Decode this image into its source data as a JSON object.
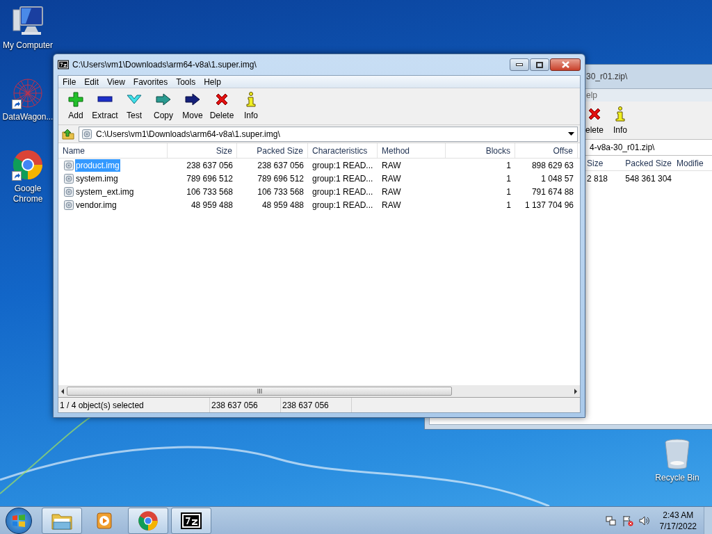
{
  "desktop_icons": [
    {
      "label": "My Computer",
      "kind": "computer"
    },
    {
      "label": "DataWagon...",
      "kind": "datawagon"
    },
    {
      "label": "Google Chrome",
      "kind": "chrome"
    },
    {
      "label": "Recycle Bin",
      "kind": "recycle"
    }
  ],
  "background_window": {
    "title": "30_r01.zip\\",
    "menu": [
      "elp"
    ],
    "toolbar": [
      {
        "label": "elete",
        "kind": "delete"
      },
      {
        "label": "Info",
        "kind": "info"
      }
    ],
    "address": "4-v8a-30_r01.zip\\",
    "columns": [
      "Size",
      "Packed Size",
      "Modifie"
    ],
    "rows": [
      [
        "2 818",
        "548 361 304"
      ]
    ]
  },
  "window": {
    "title": "C:\\Users\\vm1\\Downloads\\arm64-v8a\\1.super.img\\",
    "menu": [
      "File",
      "Edit",
      "View",
      "Favorites",
      "Tools",
      "Help"
    ],
    "toolbar": [
      {
        "label": "Add",
        "kind": "add"
      },
      {
        "label": "Extract",
        "kind": "extract"
      },
      {
        "label": "Test",
        "kind": "test"
      },
      {
        "label": "Copy",
        "kind": "copy"
      },
      {
        "label": "Move",
        "kind": "move"
      },
      {
        "label": "Delete",
        "kind": "delete"
      },
      {
        "label": "Info",
        "kind": "info"
      }
    ],
    "address": "C:\\Users\\vm1\\Downloads\\arm64-v8a\\1.super.img\\",
    "columns": [
      "Name",
      "Size",
      "Packed Size",
      "Characteristics",
      "Method",
      "Blocks",
      "Offse"
    ],
    "rows": [
      {
        "selected": true,
        "cells": [
          "product.img",
          "238 637 056",
          "238 637 056",
          "group:1 READ...",
          "RAW",
          "1",
          "898 629 63"
        ]
      },
      {
        "selected": false,
        "cells": [
          "system.img",
          "789 696 512",
          "789 696 512",
          "group:1 READ...",
          "RAW",
          "1",
          "1 048 57"
        ]
      },
      {
        "selected": false,
        "cells": [
          "system_ext.img",
          "106 733 568",
          "106 733 568",
          "group:1 READ...",
          "RAW",
          "1",
          "791 674 88"
        ]
      },
      {
        "selected": false,
        "cells": [
          "vendor.img",
          "48 959 488",
          "48 959 488",
          "group:1 READ...",
          "RAW",
          "1",
          "1 137 704 96"
        ]
      }
    ],
    "status": [
      "1 / 4 object(s) selected",
      "238 637 056",
      "238 637 056"
    ]
  },
  "taskbar": {
    "items": [
      {
        "kind": "explorer",
        "open": true
      },
      {
        "kind": "media",
        "open": false
      },
      {
        "kind": "chrome",
        "open": true
      },
      {
        "kind": "sevenzip",
        "open": true
      }
    ],
    "clock": {
      "time": "2:43 AM",
      "date": "7/17/2022"
    }
  }
}
